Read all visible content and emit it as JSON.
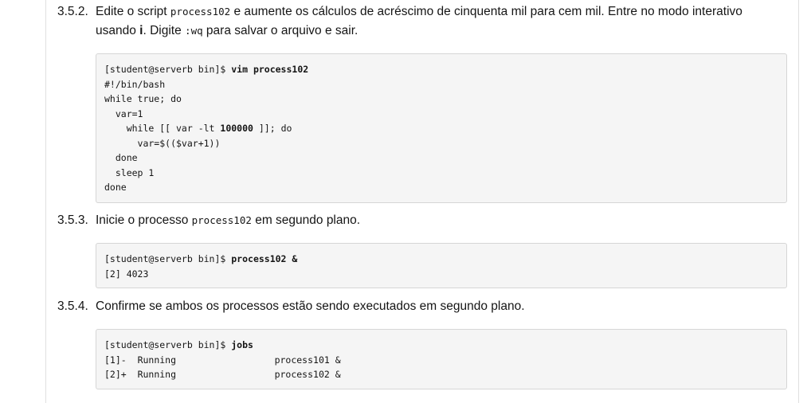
{
  "steps": [
    {
      "number": "3.5.2.",
      "line1_a": "Edite o script ",
      "line1_code": "process102",
      "line1_b": " e aumente os cálculos de acréscimo de cinquenta mil para cem mil. Entre no modo interativo",
      "line2_a": "usando ",
      "line2_key": "i",
      "line2_b": ". Digite ",
      "line2_code": ":wq",
      "line2_c": " para salvar o arquivo e sair."
    },
    {
      "number": "3.5.3.",
      "text_a": "Inicie o processo ",
      "text_code": "process102",
      "text_b": " em segundo plano."
    },
    {
      "number": "3.5.4.",
      "text": "Confirme se ambos os processos estão sendo executados em segundo plano."
    }
  ],
  "code_blocks": [
    {
      "prompt": "[student@serverb bin]$ ",
      "command": "vim process102",
      "lines": [
        "#!/bin/bash",
        "while true; do",
        "  var=1",
        "    while [[ var -lt ",
        "      var=$(($var+1))",
        "  done",
        "  sleep 1",
        "done"
      ],
      "bold_value": "100000",
      "after_bold": " ]]; do"
    },
    {
      "prompt": "[student@serverb bin]$ ",
      "command": "process102 &",
      "output": "[2] 4023"
    },
    {
      "prompt": "[student@serverb bin]$ ",
      "command": "jobs",
      "jobs": [
        {
          "id": "[1]-",
          "state": "Running",
          "cmd": "process101 &"
        },
        {
          "id": "[2]+",
          "state": "Running",
          "cmd": "process102 &"
        }
      ]
    }
  ]
}
